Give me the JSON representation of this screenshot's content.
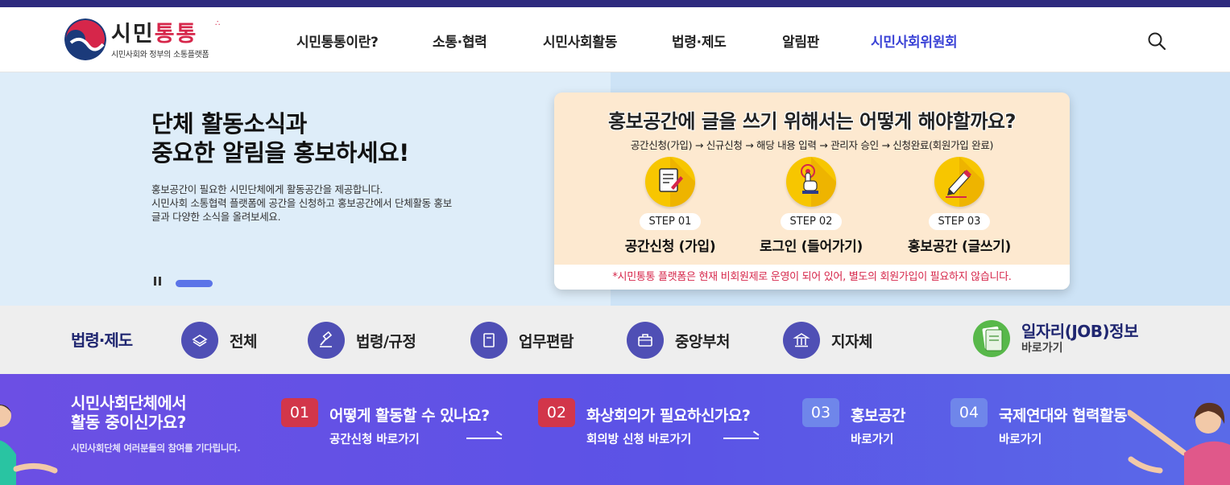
{
  "header": {
    "logo_title_plain": "시민",
    "logo_title_red": "통통",
    "logo_subtitle": "시민사회와 정부의 소통플랫폼",
    "nav": [
      {
        "label": "시민통통이란?"
      },
      {
        "label": "소통·협력"
      },
      {
        "label": "시민사회활동"
      },
      {
        "label": "법령·제도"
      },
      {
        "label": "알림판"
      },
      {
        "label": "시민사회위원회",
        "active": true
      }
    ],
    "search_icon": "search-icon"
  },
  "hero": {
    "title_line1": "단체 활동소식과",
    "title_line2": "중요한 알림을 홍보하세요!",
    "desc_line1": "홍보공간이 필요한 시민단체에게 활동공간을 제공합니다.",
    "desc_line2": "시민사회 소통협력 플랫폼에 공간을 신청하고 홍보공간에서 단체활동 홍보",
    "desc_line3": "글과 다양한 소식을 올려보세요.",
    "promo": {
      "title": "홍보공간에 글을 쓰기 위해서는 어떻게 해야할까요?",
      "flow": "공간신청(가입) → 신규신청 → 해당 내용 입력 → 관리자 승인 → 신청완료(회원가입 완료)",
      "steps": [
        {
          "badge": "STEP 01",
          "name": "공간신청 (가입)",
          "icon": "document-pen-icon"
        },
        {
          "badge": "STEP 02",
          "name": "로그인 (들어가기)",
          "icon": "touch-hand-icon"
        },
        {
          "badge": "STEP 03",
          "name": "홍보공간 (글쓰기)",
          "icon": "pencil-icon"
        }
      ],
      "note": "*시민통통 플랫폼은 현재 비회원제로 운영이 되어 있어, 별도의 회원가입이 필요하지 않습니다."
    }
  },
  "law": {
    "title": "법령·제도",
    "items": [
      {
        "label": "전체",
        "icon": "stack-icon"
      },
      {
        "label": "법령/규정",
        "icon": "gavel-icon"
      },
      {
        "label": "업무편람",
        "icon": "manual-icon"
      },
      {
        "label": "중앙부처",
        "icon": "briefcase-icon"
      },
      {
        "label": "지자체",
        "icon": "building-icon"
      }
    ],
    "job_title": "일자리(JOB)정보",
    "job_sub": "바로가기"
  },
  "cta": {
    "title_line1": "시민사회단체에서",
    "title_line2": "활동 중이신가요?",
    "sub": "시민사회단체 여러분들의 참여를 기다립니다.",
    "items": [
      {
        "num": "01",
        "head": "어떻게 활동할 수 있나요?",
        "link": "공간신청 바로가기"
      },
      {
        "num": "02",
        "head": "화상회의가 필요하신가요?",
        "link": "회의방 신청 바로가기"
      },
      {
        "num": "03",
        "head": "홍보공간",
        "link": "바로가기"
      },
      {
        "num": "04",
        "head": "국제연대와 협력활동",
        "link": "바로가기"
      }
    ]
  },
  "colors": {
    "brand_red": "#d6264a",
    "brand_navy": "#1f2670",
    "active_nav": "#3b43d6",
    "cta_purple": "#6c4fe4"
  }
}
